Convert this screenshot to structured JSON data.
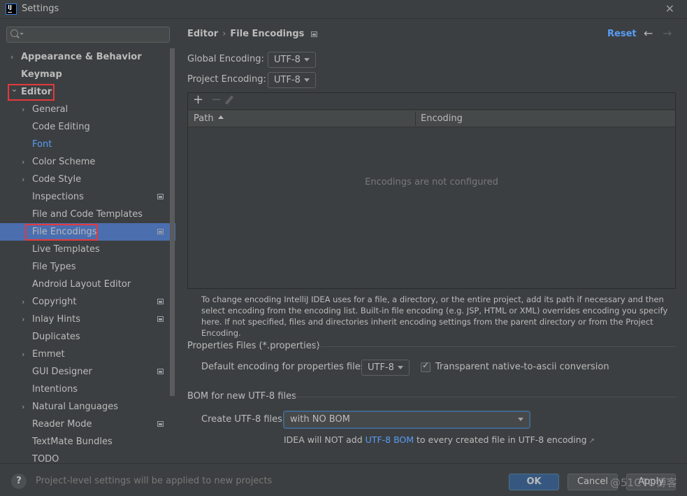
{
  "window": {
    "title": "Settings",
    "app_icon_label": "IJ",
    "close_glyph": "✕"
  },
  "sidebar": {
    "search_placeholder": "",
    "items": [
      {
        "label": "Appearance & Behavior",
        "level": 0,
        "expandable": true,
        "expanded": false
      },
      {
        "label": "Keymap",
        "level": 0,
        "expandable": false
      },
      {
        "label": "Editor",
        "level": 0,
        "expandable": true,
        "expanded": true
      },
      {
        "label": "General",
        "level": 1,
        "expandable": true
      },
      {
        "label": "Code Editing",
        "level": 1
      },
      {
        "label": "Font",
        "level": 1,
        "link": true
      },
      {
        "label": "Color Scheme",
        "level": 1,
        "expandable": true
      },
      {
        "label": "Code Style",
        "level": 1,
        "expandable": true
      },
      {
        "label": "Inspections",
        "level": 1,
        "project_level": true
      },
      {
        "label": "File and Code Templates",
        "level": 1
      },
      {
        "label": "File Encodings",
        "level": 1,
        "project_level": true,
        "selected": true
      },
      {
        "label": "Live Templates",
        "level": 1
      },
      {
        "label": "File Types",
        "level": 1
      },
      {
        "label": "Android Layout Editor",
        "level": 1
      },
      {
        "label": "Copyright",
        "level": 1,
        "expandable": true,
        "project_level": true
      },
      {
        "label": "Inlay Hints",
        "level": 1,
        "expandable": true,
        "project_level": true
      },
      {
        "label": "Duplicates",
        "level": 1
      },
      {
        "label": "Emmet",
        "level": 1,
        "expandable": true
      },
      {
        "label": "GUI Designer",
        "level": 1,
        "project_level": true
      },
      {
        "label": "Intentions",
        "level": 1
      },
      {
        "label": "Natural Languages",
        "level": 1,
        "expandable": true
      },
      {
        "label": "Reader Mode",
        "level": 1,
        "project_level": true
      },
      {
        "label": "TextMate Bundles",
        "level": 1
      },
      {
        "label": "TODO",
        "level": 1
      }
    ]
  },
  "header": {
    "breadcrumb_parent": "Editor",
    "breadcrumb_separator": "›",
    "breadcrumb_current": "File Encodings",
    "reset_label": "Reset",
    "back_glyph": "←",
    "forward_glyph": "→"
  },
  "encodings": {
    "global_label": "Global Encoding:",
    "global_value": "UTF-8",
    "project_label": "Project Encoding:",
    "project_value": "UTF-8"
  },
  "table": {
    "toolbar": {
      "add": "+",
      "remove": "−"
    },
    "columns": [
      "Path",
      "Encoding"
    ],
    "sorted_column": "Path",
    "sort_direction": "ascending",
    "rows": [],
    "empty_text": "Encodings are not configured"
  },
  "help_text": "To change encoding IntelliJ IDEA uses for a file, a directory, or the entire project, add its path if necessary and then select encoding from the encoding list. Built-in file encoding (e.g. JSP, HTML or XML) overrides encoding you specify here. If not specified, files and directories inherit encoding settings from the parent directory or from the Project Encoding.",
  "properties": {
    "section_title": "Properties Files (*.properties)",
    "default_label": "Default encoding for properties files:",
    "default_value": "UTF-8",
    "native_to_ascii_label": "Transparent native-to-ascii conversion",
    "native_to_ascii_checked": true
  },
  "bom": {
    "section_title": "BOM for new UTF-8 files",
    "create_label": "Create UTF-8 files:",
    "create_value": "with NO BOM",
    "note_prefix": "IDEA will NOT add ",
    "note_link": "UTF-8 BOM",
    "note_suffix": " to every created file in UTF-8 encoding",
    "note_ext_glyph": "↗"
  },
  "footer": {
    "help_glyph": "?",
    "message": "Project-level settings will be applied to new projects",
    "ok_label": "OK",
    "cancel_label": "Cancel",
    "apply_label": "Apply",
    "watermark": "@51CTO博客"
  },
  "colors": {
    "background": "#3c3f41",
    "selection": "#4b6eaf",
    "link": "#589df6",
    "ok_button": "#365880",
    "annotation_red": "#e4393c"
  }
}
